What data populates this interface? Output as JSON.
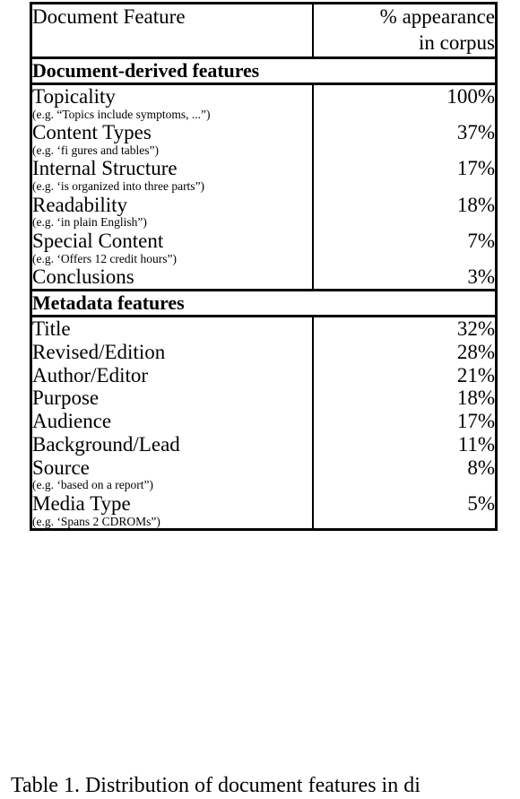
{
  "table": {
    "columns": [
      {
        "header": "Document Feature",
        "align": "left"
      },
      {
        "header_line1": "% appearance",
        "header_line2": "in corpus",
        "align": "right"
      }
    ],
    "sections": [
      {
        "title": "Document-derived features",
        "rows": [
          {
            "feature": "Topicality",
            "example": "(e.g. “Topics include symptoms, ...”)",
            "percent": "100%"
          },
          {
            "feature": "Content Types",
            "example": "(e.g. ‘fi gures and tables”)",
            "percent": "37%"
          },
          {
            "feature": "Internal Structure",
            "example": "(e.g. ‘is organized into three parts”)",
            "percent": "17%"
          },
          {
            "feature": "Readability",
            "example": "(e.g. ‘in plain English”)",
            "percent": "18%"
          },
          {
            "feature": "Special Content",
            "example": "(e.g. ‘Offers 12 credit hours”)",
            "percent": "7%"
          },
          {
            "feature": "Conclusions",
            "example": "",
            "percent": "3%"
          }
        ]
      },
      {
        "title": "Metadata features",
        "rows": [
          {
            "feature": "Title",
            "example": "",
            "percent": "32%"
          },
          {
            "feature": "Revised/Edition",
            "example": "",
            "percent": "28%"
          },
          {
            "feature": "Author/Editor",
            "example": "",
            "percent": "21%"
          },
          {
            "feature": "Purpose",
            "example": "",
            "percent": "18%"
          },
          {
            "feature": "Audience",
            "example": "",
            "percent": "17%"
          },
          {
            "feature": "Background/Lead",
            "example": "",
            "percent": "11%"
          },
          {
            "feature": "Source",
            "example": "(e.g. ‘based on a report”)",
            "percent": "8%"
          },
          {
            "feature": "Media Type",
            "example": "(e.g. ‘Spans 2 CDROMs”)",
            "percent": "5%"
          }
        ]
      }
    ]
  },
  "caption": "Table 1. Distribution of document features in di"
}
